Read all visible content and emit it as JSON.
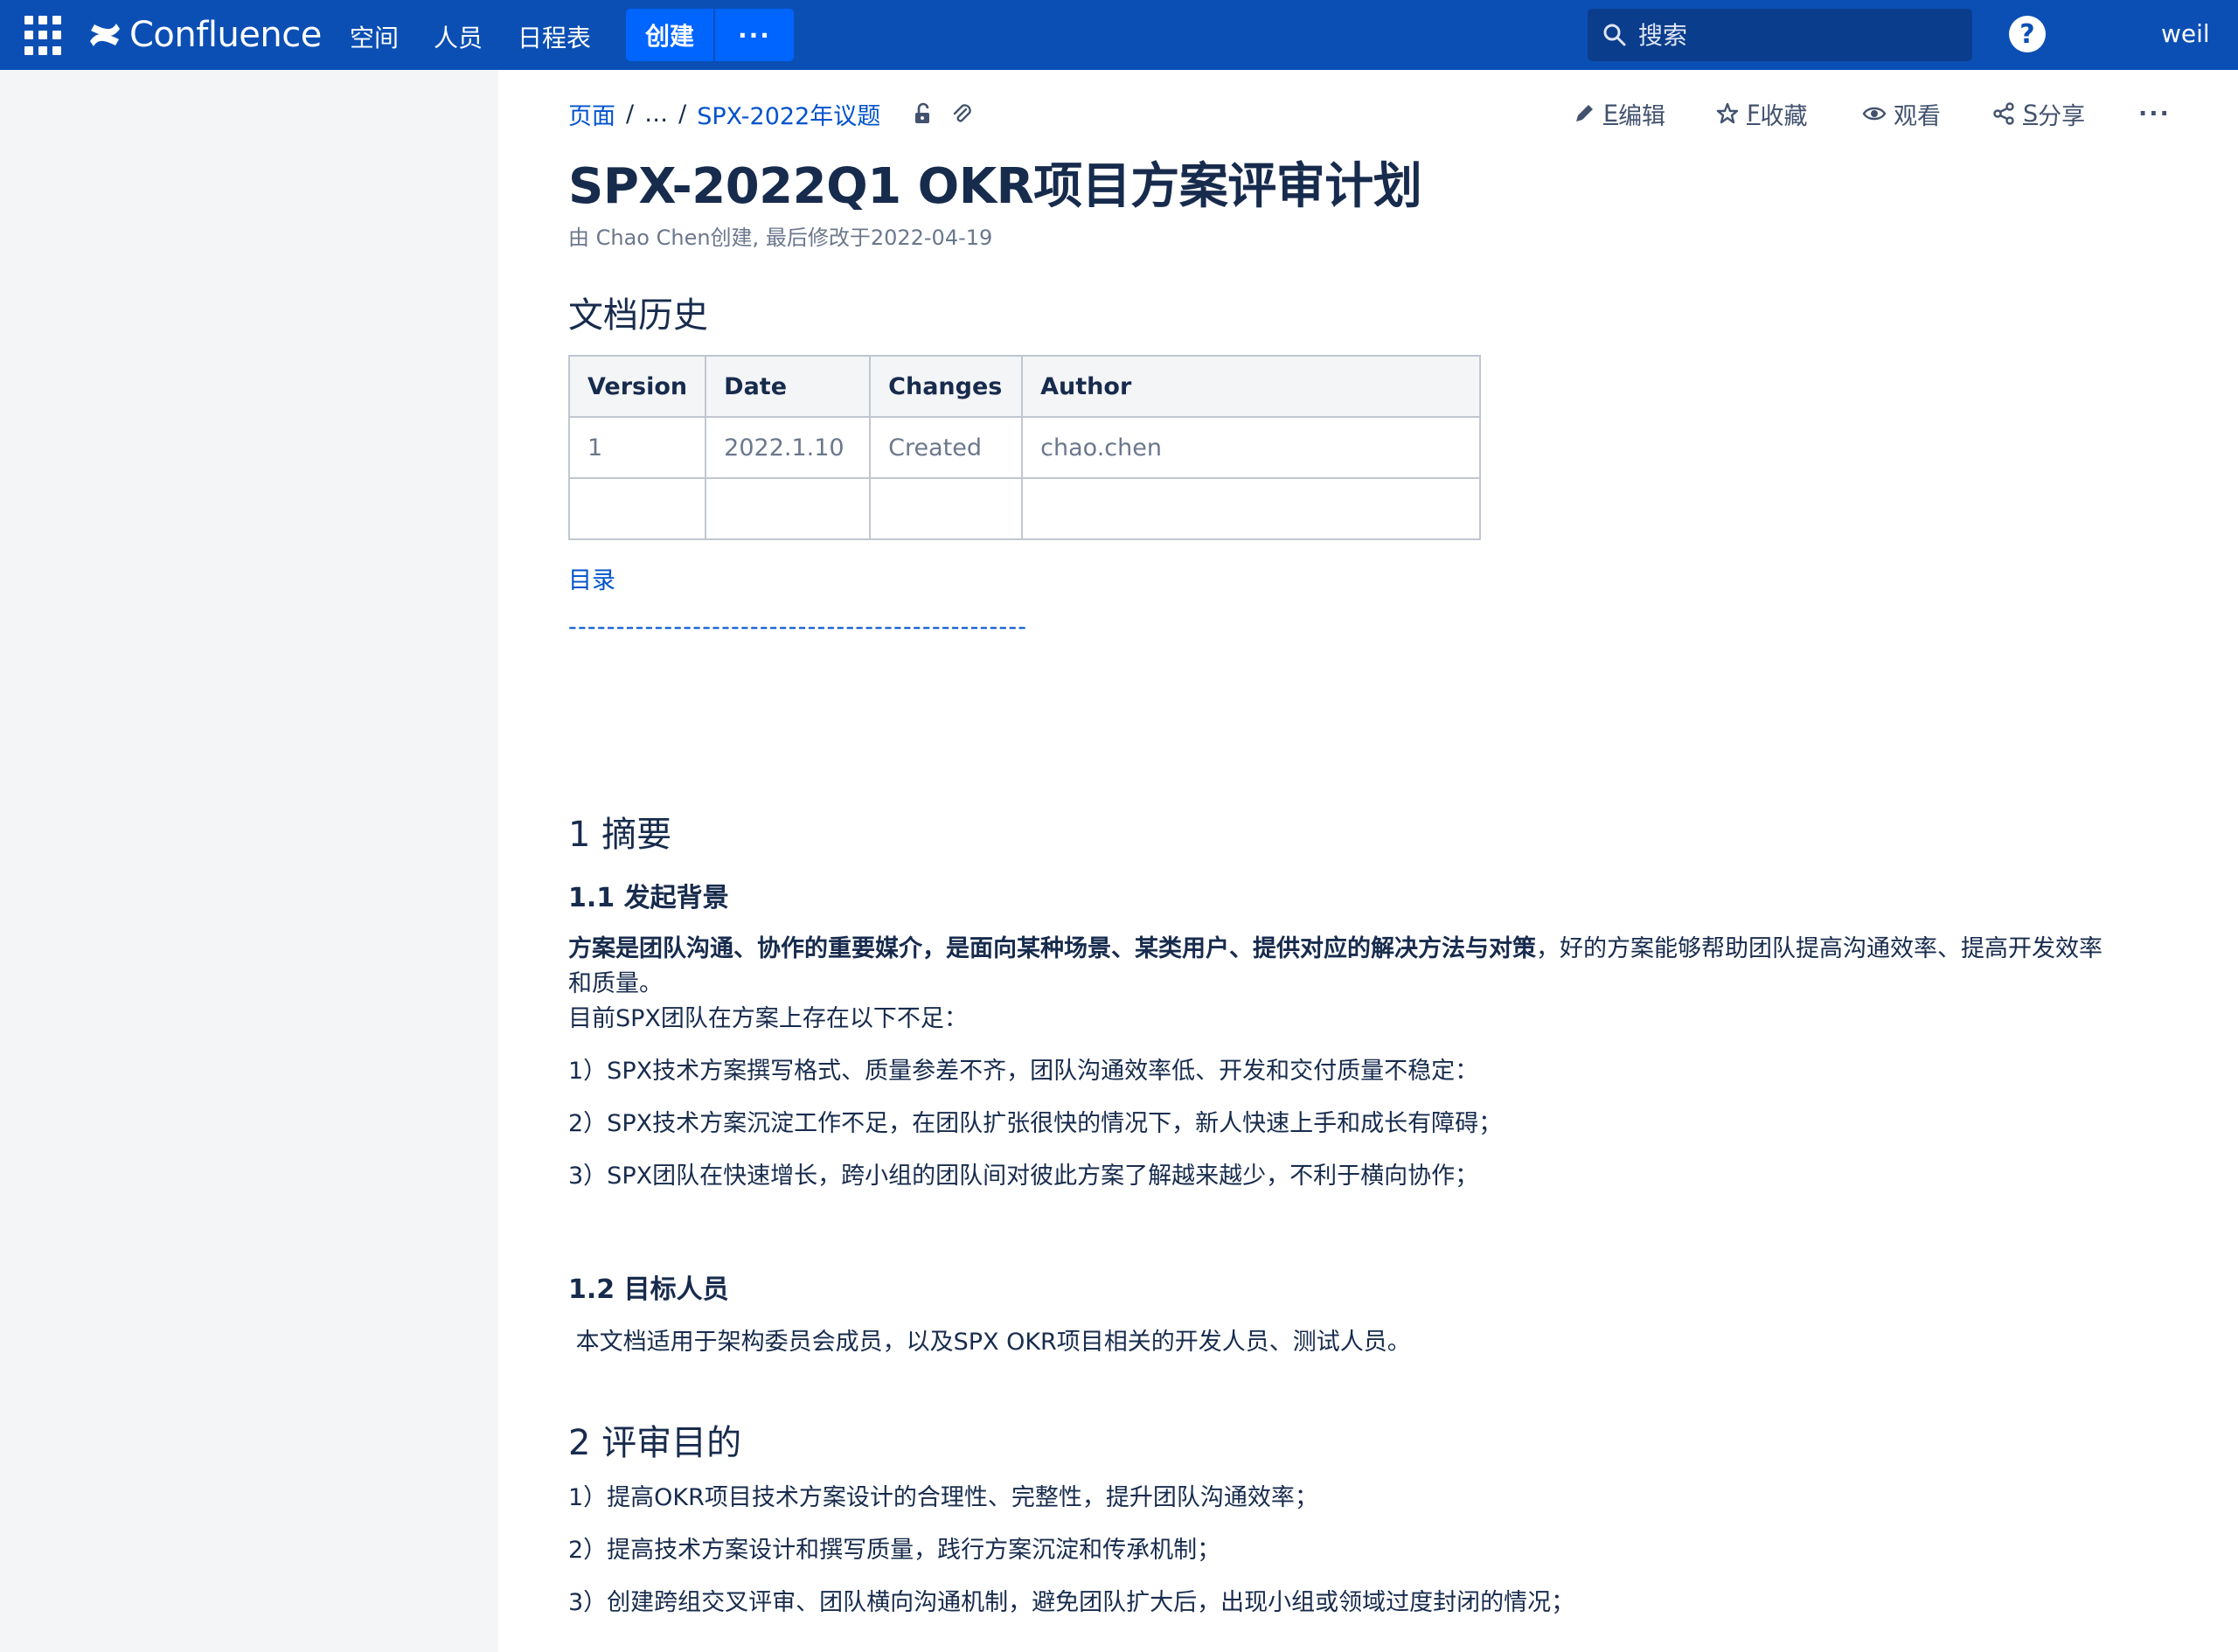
{
  "nav": {
    "brand": "Confluence",
    "items": [
      "空间",
      "人员",
      "日程表"
    ],
    "create": "创建",
    "more": "···",
    "search_placeholder": "搜索",
    "help": "?",
    "user": "weil"
  },
  "breadcrumb": {
    "root": "页面",
    "ellipsis": "…",
    "parent": "SPX-2022年议题"
  },
  "actions": {
    "edit_key": "E",
    "edit": "编辑",
    "fav_key": "F",
    "fav": "收藏",
    "watch": "观看",
    "share_key": "S",
    "share": "分享",
    "more": "···"
  },
  "page": {
    "title": "SPX-2022Q1 OKR项目方案评审计划",
    "byline": "由 Chao Chen创建, 最后修改于2022-04-19",
    "history_heading": "文档历史",
    "history_table": {
      "headers": [
        "Version",
        "Date",
        "Changes",
        "Author"
      ],
      "rows": [
        [
          "1",
          "2022.1.10",
          "Created",
          "chao.chen"
        ],
        [
          "",
          "",
          "",
          ""
        ]
      ]
    },
    "toc_label": "目录",
    "toc_line": "------------------------------------------------",
    "s1_heading": "1 摘要",
    "s11_heading": "1.1 发起背景",
    "s11_bold": "方案是团队沟通、协作的重要媒介，是面向某种场景、某类用户、提供对应的解决方法与对策",
    "s11_rest": "，好的方案能够帮助团队提高沟通效率、提高开发效率和质量。",
    "s11_intro": "目前SPX团队在方案上存在以下不足：",
    "s11_items": [
      "1）SPX技术方案撰写格式、质量参差不齐，团队沟通效率低、开发和交付质量不稳定：",
      "2）SPX技术方案沉淀工作不足，在团队扩张很快的情况下，新人快速上手和成长有障碍；",
      "3）SPX团队在快速增长，跨小组的团队间对彼此方案了解越来越少，不利于横向协作；"
    ],
    "s12_heading": "1.2 目标人员",
    "s12_text": " 本文档适用于架构委员会成员，以及SPX OKR项目相关的开发人员、测试人员。",
    "s2_heading": "2 评审目的",
    "s2_items": [
      "1）提高OKR项目技术方案设计的合理性、完整性，提升团队沟通效率；",
      "2）提高技术方案设计和撰写质量，践行方案沉淀和传承机制；",
      "3）创建跨组交叉评审、团队横向沟通机制，避免团队扩大后，出现小组或领域过度封闭的情况；"
    ]
  },
  "colors": {
    "nav_bg": "#0b4fb4",
    "create_bg": "#0065ff",
    "link": "#0052cc",
    "text": "#172b4d",
    "sidebar_bg": "#f4f5f7"
  }
}
